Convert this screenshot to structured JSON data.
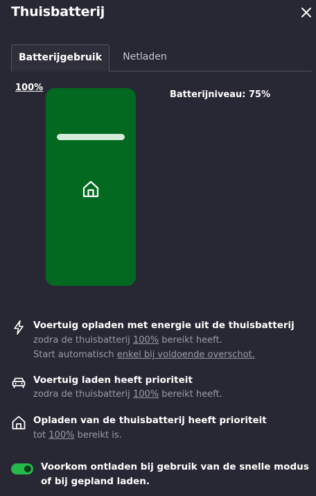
{
  "header": {
    "title": "Thuisbatterij",
    "close_icon": "close-icon"
  },
  "tabs": [
    {
      "label": "Batterijgebruik",
      "active": true
    },
    {
      "label": "Netladen",
      "active": false
    }
  ],
  "battery": {
    "limit_link": "100%",
    "level_label": "Batterijniveau:",
    "level_value": "75%",
    "fill_color": "#036920",
    "marker_level": 0.75,
    "icon": "home-icon"
  },
  "options": [
    {
      "icon": "lightning-icon",
      "title": "Voertuig opladen met energie uit de thuisbatterij",
      "line1_pre": "zodra de thuisbatterij ",
      "line1_link": "100%",
      "line1_post": " bereikt heeft.",
      "line2_pre": "Start automatisch ",
      "line2_link": "enkel bij voldoende overschot."
    },
    {
      "icon": "car-icon",
      "title": "Voertuig laden heeft prioriteit",
      "line1_pre": "zodra de thuisbatterij ",
      "line1_link": "100%",
      "line1_post": " bereikt heeft."
    },
    {
      "icon": "home-icon",
      "title": "Opladen van de thuisbatterij heeft prioriteit",
      "line1_pre": "tot ",
      "line1_link": "100%",
      "line1_post": " bereikt is."
    }
  ],
  "toggle": {
    "on": true,
    "label": "Voorkom ontladen bij gebruik van de snelle modus of bij gepland laden.",
    "color": "#25b84a"
  },
  "colors": {
    "background": "#282834",
    "subtext": "#9b9ba6",
    "accent_green": "#25b84a"
  }
}
